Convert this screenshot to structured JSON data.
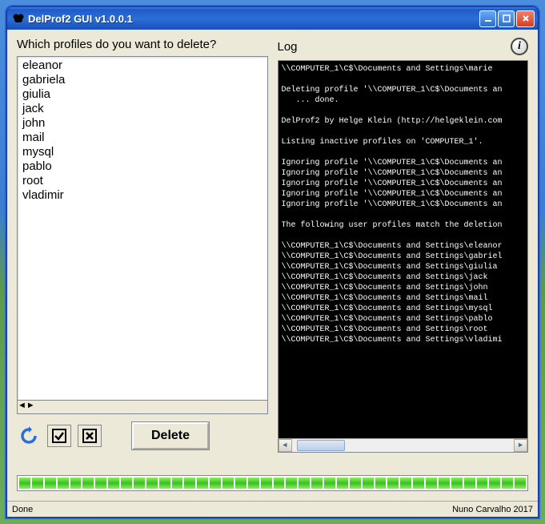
{
  "window": {
    "title": "DelProf2 GUI v1.0.0.1"
  },
  "profiles": {
    "label": "Which profiles do you want to delete?",
    "items": [
      "eleanor",
      "gabriela",
      "giulia",
      "jack",
      "john",
      "mail",
      "mysql",
      "pablo",
      "root",
      "vladimir"
    ]
  },
  "log": {
    "label": "Log",
    "lines": [
      "\\\\COMPUTER_1\\C$\\Documents and Settings\\marie",
      "",
      "Deleting profile '\\\\COMPUTER_1\\C$\\Documents an",
      "   ... done.",
      "",
      "DelProf2 by Helge Klein (http://helgeklein.com",
      "",
      "Listing inactive profiles on 'COMPUTER_1'.",
      "",
      "Ignoring profile '\\\\COMPUTER_1\\C$\\Documents an",
      "Ignoring profile '\\\\COMPUTER_1\\C$\\Documents an",
      "Ignoring profile '\\\\COMPUTER_1\\C$\\Documents an",
      "Ignoring profile '\\\\COMPUTER_1\\C$\\Documents an",
      "Ignoring profile '\\\\COMPUTER_1\\C$\\Documents an",
      "",
      "The following user profiles match the deletion",
      "",
      "\\\\COMPUTER_1\\C$\\Documents and Settings\\eleanor",
      "\\\\COMPUTER_1\\C$\\Documents and Settings\\gabriel",
      "\\\\COMPUTER_1\\C$\\Documents and Settings\\giulia",
      "\\\\COMPUTER_1\\C$\\Documents and Settings\\jack",
      "\\\\COMPUTER_1\\C$\\Documents and Settings\\john",
      "\\\\COMPUTER_1\\C$\\Documents and Settings\\mail",
      "\\\\COMPUTER_1\\C$\\Documents and Settings\\mysql",
      "\\\\COMPUTER_1\\C$\\Documents and Settings\\pablo",
      "\\\\COMPUTER_1\\C$\\Documents and Settings\\root",
      "\\\\COMPUTER_1\\C$\\Documents and Settings\\vladimi"
    ]
  },
  "toolbar": {
    "delete_label": "Delete"
  },
  "status": {
    "left": "Done",
    "right": "Nuno Carvalho 2017"
  },
  "progress": {
    "segments": 40
  }
}
